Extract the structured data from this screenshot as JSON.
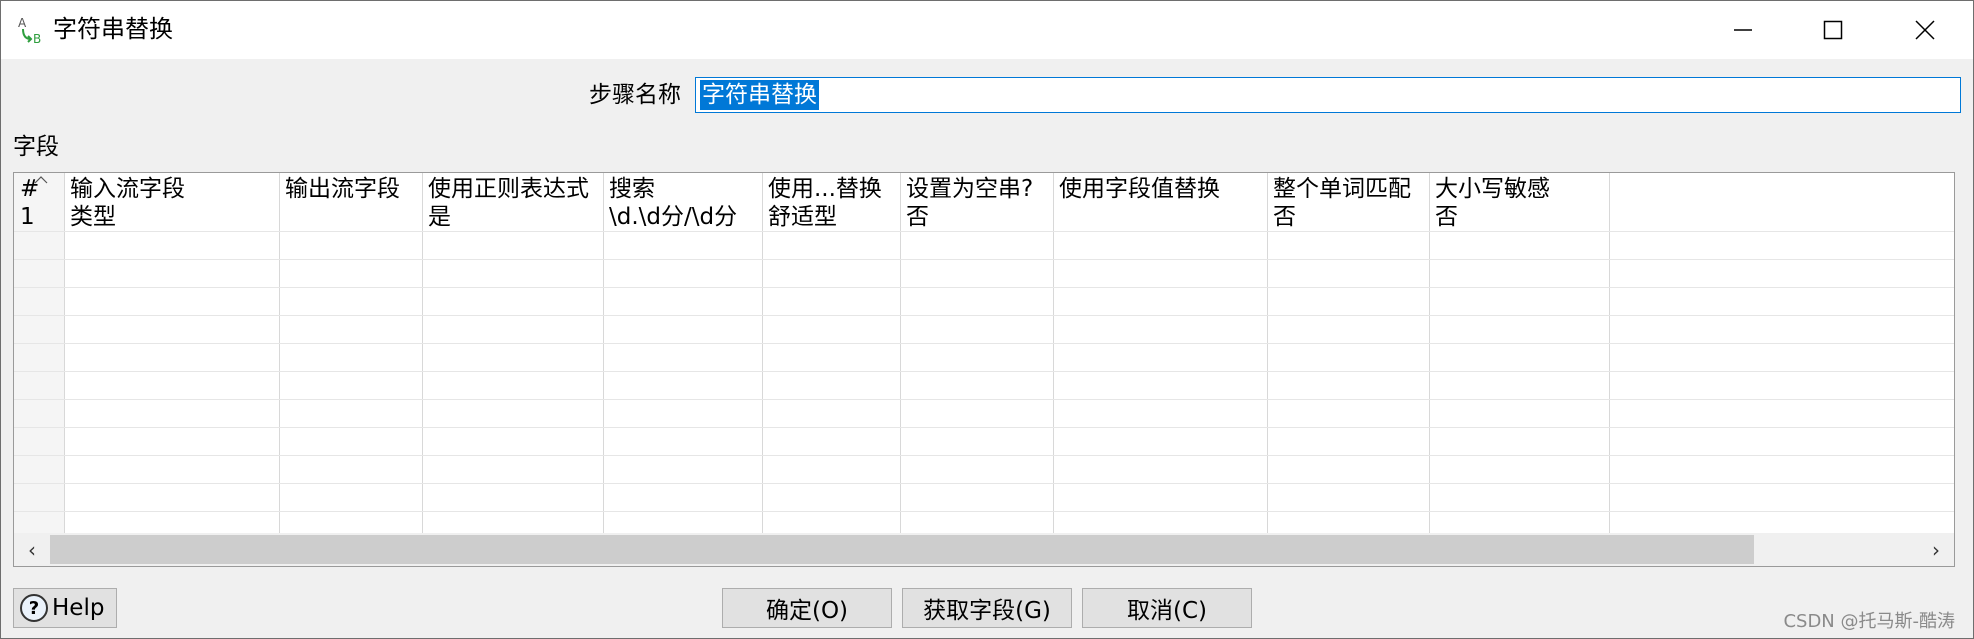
{
  "window": {
    "title": "字符串替换",
    "icon": "string-replace-icon",
    "controls": [
      "minimize-icon",
      "maximize-icon",
      "close-icon"
    ]
  },
  "step": {
    "label": "步骤名称",
    "value": "字符串替换"
  },
  "fields": {
    "label": "字段",
    "columns": [
      "#",
      "输入流字段",
      "输出流字段",
      "使用正则表达式",
      "搜索",
      "使用...替换",
      "设置为空串?",
      "使用字段值替换",
      "整个单词匹配",
      "大小写敏感"
    ],
    "rows": [
      [
        "1",
        "类型",
        "",
        "是",
        "\\d.\\d分/\\d分",
        "舒适型",
        "否",
        "",
        "否",
        "否"
      ]
    ]
  },
  "buttons": {
    "help": "Help",
    "ok": "确定(O)",
    "get_fields": "获取字段(G)",
    "cancel": "取消(C)"
  },
  "watermark": "CSDN @托马斯-酷涛",
  "colors": {
    "selection": "#0078d7",
    "button_bg": "#e1e1e1",
    "scroll_thumb": "#cdcdcd"
  }
}
